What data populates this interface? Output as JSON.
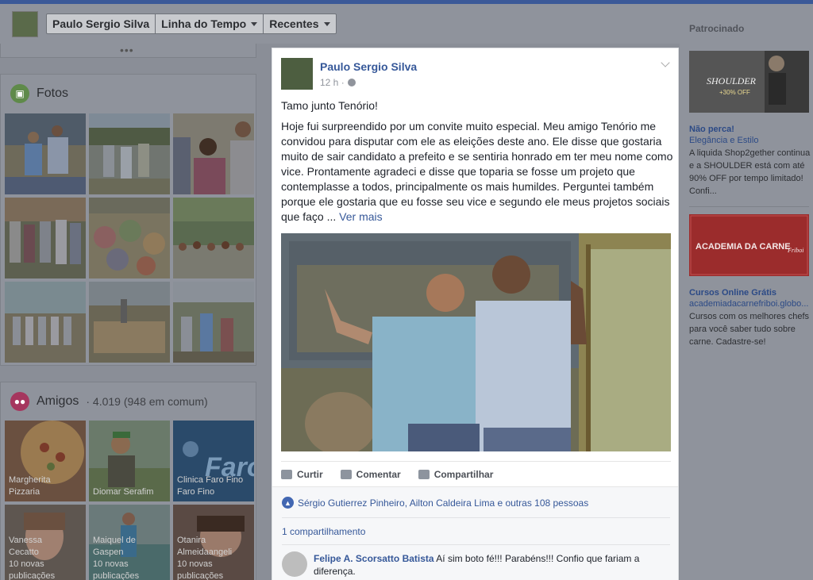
{
  "nav": {
    "profile_name": "Paulo Sergio Silva",
    "timeline": "Linha do Tempo",
    "recent": "Recentes"
  },
  "left": {
    "more_dots": "•••",
    "photos_title": "Fotos",
    "friends_title": "Amigos",
    "friends_count": "· 4.019 (948 em comum)",
    "friends": [
      {
        "name": "Margherita Pizzaria"
      },
      {
        "name": "Diomar Serafim"
      },
      {
        "name": "Clinica Faro Fino Faro Fino"
      },
      {
        "name": "Vanessa Cecatto",
        "sub": "10 novas publicações"
      },
      {
        "name": "Maiquel de Gaspen",
        "sub": "10 novas publicações"
      },
      {
        "name": "Otanira Almeidaangeli",
        "sub": "10 novas publicações"
      }
    ]
  },
  "post": {
    "author": "Paulo Sergio Silva",
    "time": "12 h ·",
    "line1": "Tamo junto Tenório!",
    "body": "Hoje fui surpreendido por um convite muito especial. Meu amigo Tenório me convidou para disputar com ele as eleições deste ano. Ele disse que gostaria muito de sair candidato a prefeito e se sentiria honrado em ter meu nome como vice. Prontamente agradeci e disse que toparia se fosse um projeto que contemplasse a todos, principalmente os mais humildes. Perguntei também porque ele gostaria que eu fosse seu vice e segundo ele meus projetos sociais que faço ...",
    "see_more": "Ver mais",
    "actions": {
      "like": "Curtir",
      "comment": "Comentar",
      "share": "Compartilhar"
    },
    "likes": "Sérgio Gutierrez Pinheiro, Ailton Caldeira Lima e outras 108 pessoas",
    "shares": "1 compartilhamento",
    "comment": {
      "author": "Felipe A. Scorsatto Batista",
      "text": "Aí sim boto fé!!! Parabéns!!! Confio que fariam a diferença."
    }
  },
  "right": {
    "sponsored": "Patrocinado",
    "ad1": {
      "image_text": "SHOULDER",
      "image_sub": "+30% OFF",
      "title": "Não perca!",
      "url": "Elegância e Estilo",
      "text": "A liquida Shop2gether continua e a SHOULDER está com até 90% OFF por tempo limitado! Confi..."
    },
    "ad2": {
      "image_text": "ACADEMIA DA CARNE",
      "image_sub": "Friboi",
      "title": "Cursos Online Grátis",
      "url": "academiadacarnefriboi.globo...",
      "text": "Cursos com os melhores chefs para você saber tudo sobre carne. Cadastre-se!"
    }
  }
}
